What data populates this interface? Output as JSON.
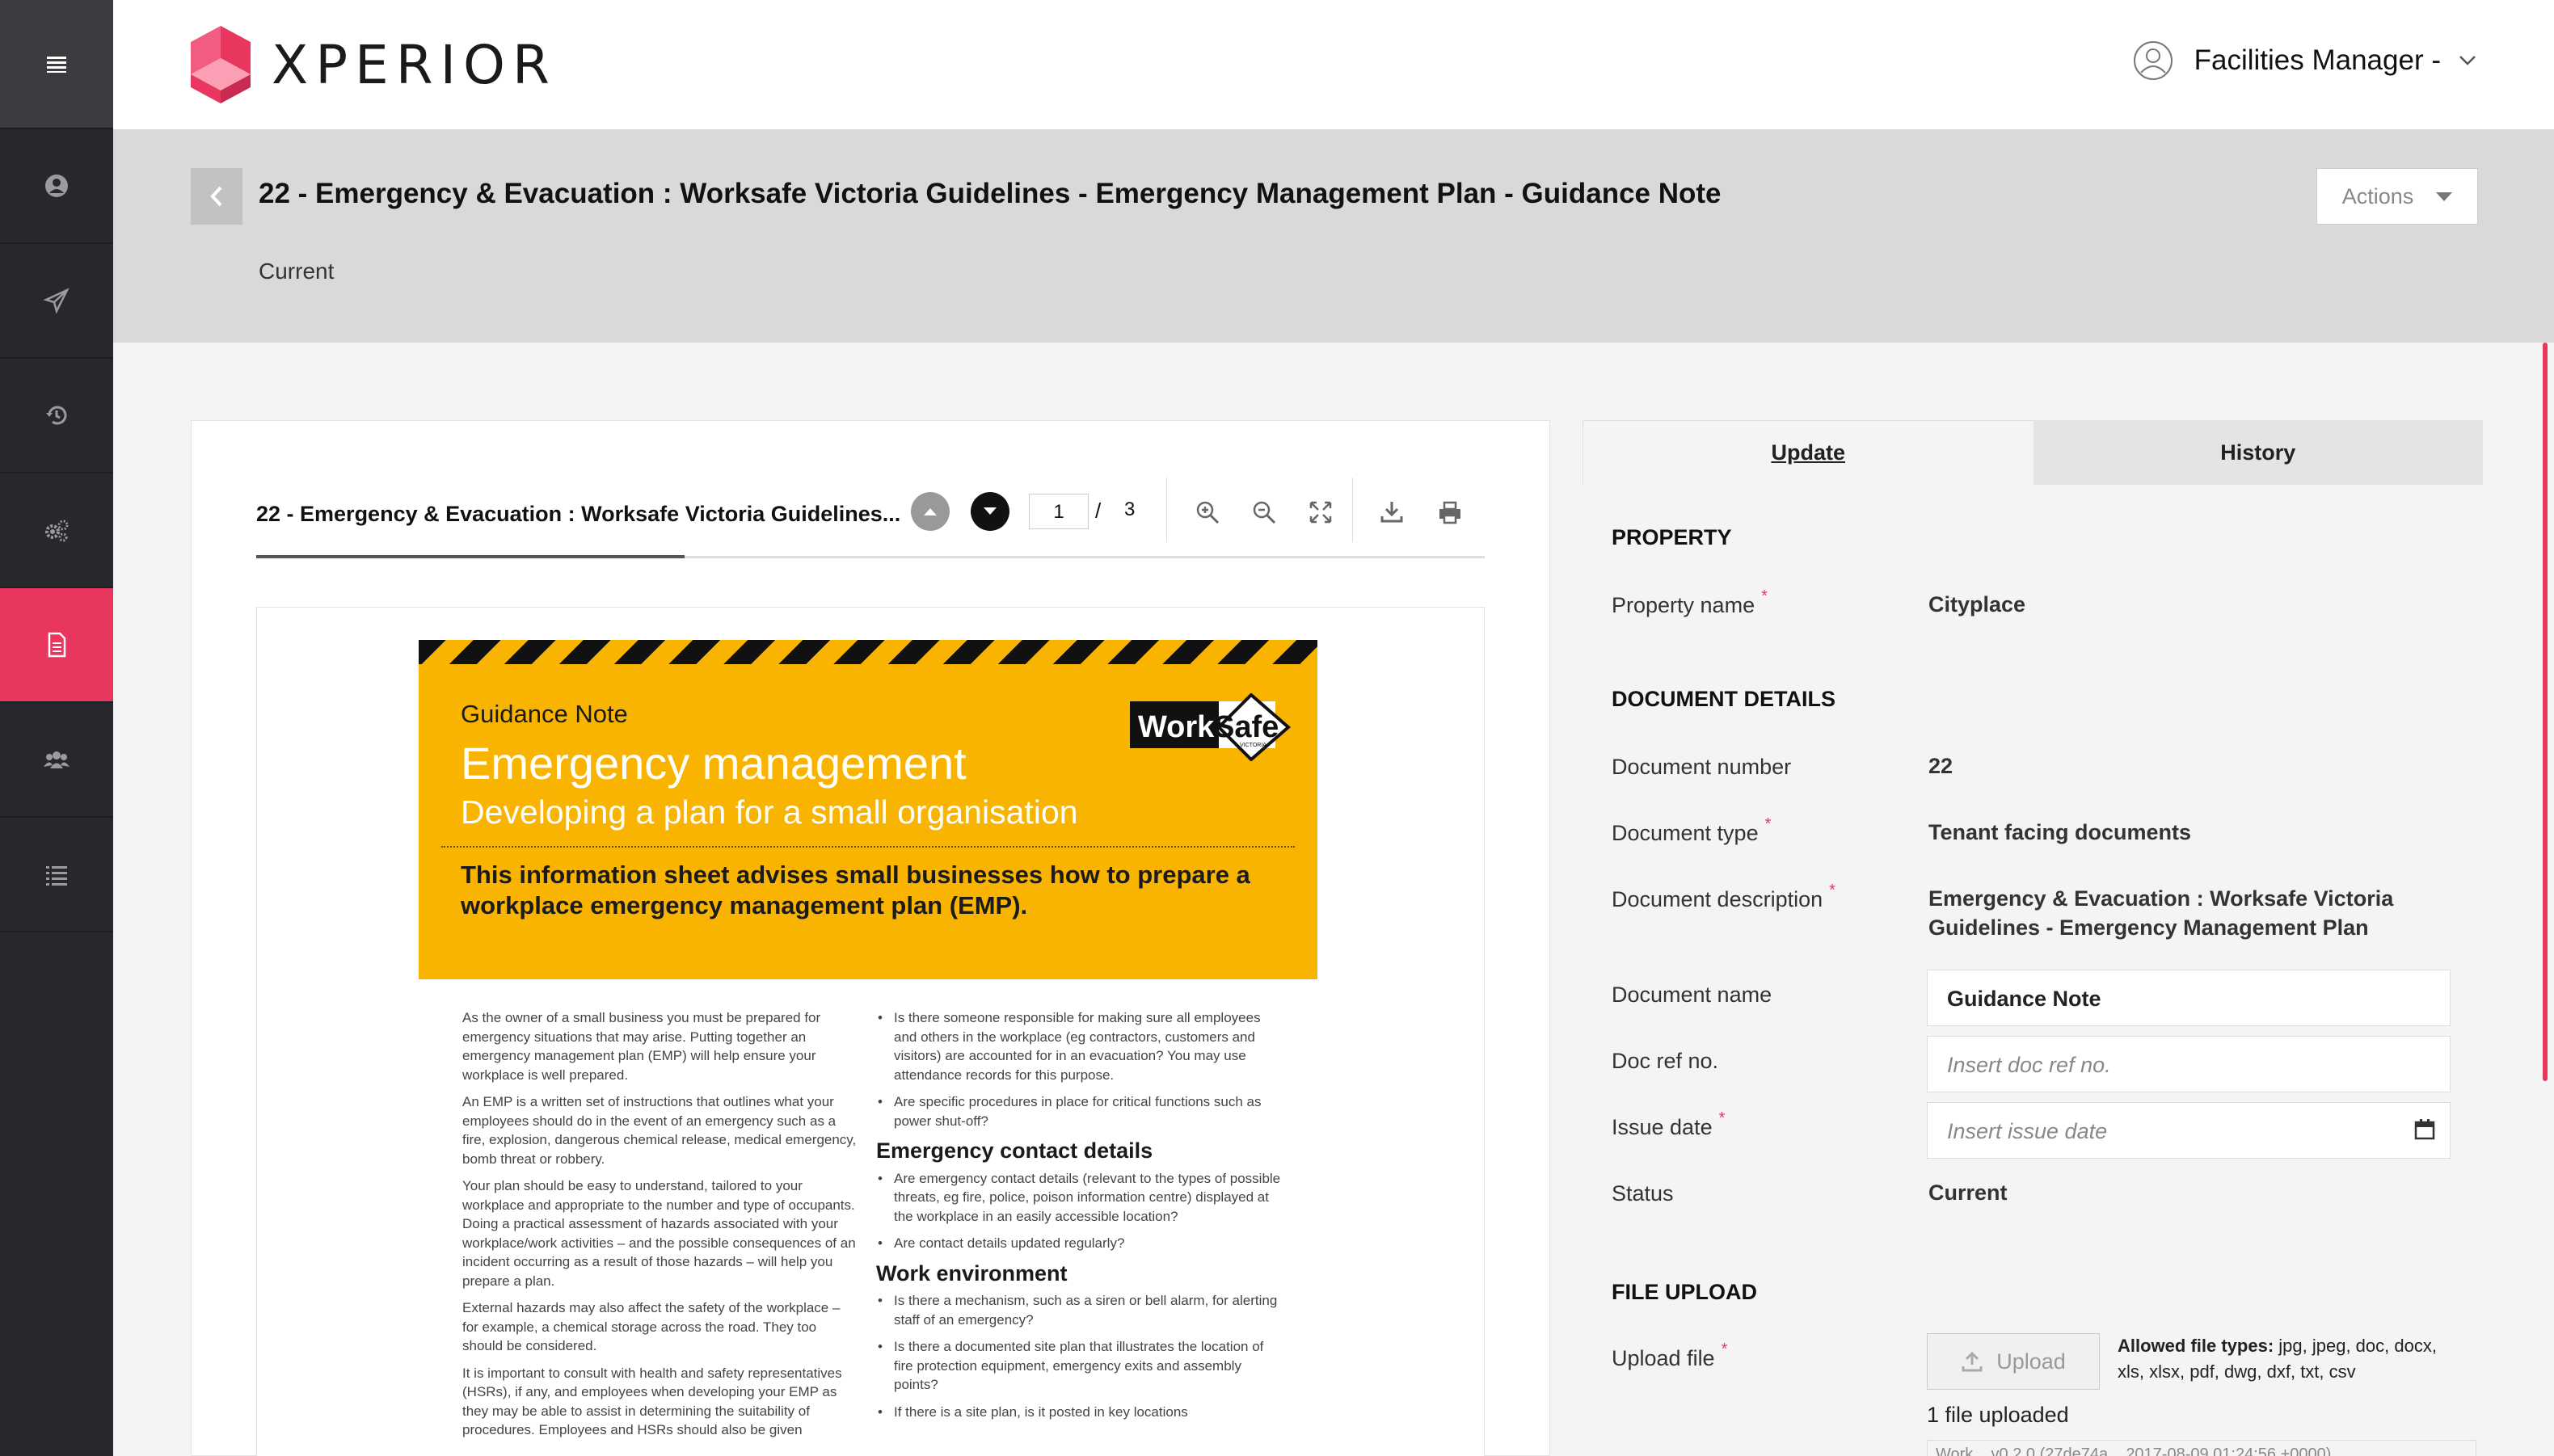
{
  "app": {
    "name": "XPERIOR",
    "user": "Facilities Manager -"
  },
  "colors": {
    "accent": "#e8365f",
    "sidebar": "#27282c",
    "banner": "#f9b401"
  },
  "sidebar": {
    "items": [
      {
        "icon": "menu-icon"
      },
      {
        "icon": "user-circle-icon"
      },
      {
        "icon": "paper-plane-icon"
      },
      {
        "icon": "history-icon"
      },
      {
        "icon": "gears-icon"
      },
      {
        "icon": "document-icon",
        "active": true
      },
      {
        "icon": "users-icon"
      },
      {
        "icon": "list-icon"
      }
    ]
  },
  "header": {
    "title": "22 - Emergency & Evacuation : Worksafe Victoria Guidelines - Emergency Management Plan - Guidance Note",
    "status": "Current",
    "actions_label": "Actions"
  },
  "viewer": {
    "title": "22 - Emergency & Evacuation : Worksafe Victoria Guidelines...",
    "current_page": "1",
    "separator": "/",
    "total_pages": "3"
  },
  "document": {
    "kicker": "Guidance Note",
    "title": "Emergency management",
    "subtitle": "Developing a plan for a small organisation",
    "description": "This information sheet advises small businesses how to prepare a workplace emergency management plan (EMP).",
    "logo_text_1": "Work",
    "logo_text_2": "Safe",
    "logo_small": "VICTORIA",
    "left_col": [
      "As the owner of a small business you must be prepared for emergency situations that may arise. Putting together an emergency management plan (EMP) will help ensure your workplace is well prepared.",
      "An EMP is a written set of instructions that outlines what your employees should do in the event of an emergency such as a fire, explosion, dangerous chemical release, medical emergency, bomb threat or robbery.",
      "Your plan should be easy to understand, tailored to your workplace and appropriate to the number and type of occupants. Doing a practical assessment of hazards associated with your workplace/work activities – and the possible consequences of an incident occurring as a result of those hazards – will help you prepare a plan.",
      "External hazards may also affect the safety of the workplace – for example, a chemical storage across the road. They too should be considered.",
      "It is important to consult with health and safety representatives (HSRs), if any, and employees when developing your EMP as they may be able to assist in determining the suitability of procedures. Employees and HSRs should also be given"
    ],
    "right_col_top": [
      "Is there someone responsible for making sure all employees and others in the workplace (eg contractors, customers and visitors) are accounted for in an evacuation? You may use attendance records for this purpose.",
      "Are specific procedures in place for critical functions such as power shut-off?"
    ],
    "heading_contact": "Emergency contact details",
    "contact_items": [
      "Are emergency contact details (relevant to the types of possible threats, eg fire, police, poison information centre) displayed at the workplace in an easily accessible location?",
      "Are contact details updated regularly?"
    ],
    "heading_work": "Work environment",
    "work_items": [
      "Is there a mechanism, such as a siren or bell alarm, for alerting staff of an emergency?",
      "Is there a documented site plan that illustrates the location of fire protection equipment, emergency exits and assembly points?",
      "If there is a site plan, is it posted in key locations"
    ]
  },
  "panel": {
    "tabs": [
      "Update",
      "History"
    ],
    "property_heading": "PROPERTY",
    "property_name_label": "Property name",
    "property_name": "Cityplace",
    "details_heading": "DOCUMENT DETAILS",
    "doc_number_label": "Document number",
    "doc_number": "22",
    "doc_type_label": "Document type",
    "doc_type": "Tenant facing documents",
    "doc_desc_label": "Document description",
    "doc_desc_1": "Emergency & Evacuation : Worksafe Victoria",
    "doc_desc_2": "Guidelines - Emergency Management Plan",
    "doc_name_label": "Document name",
    "doc_name": "Guidance Note",
    "doc_ref_label": "Doc ref no.",
    "doc_ref_placeholder": "Insert doc ref no.",
    "issue_date_label": "Issue date",
    "issue_date_placeholder": "Insert issue date",
    "status_label": "Status",
    "status": "Current",
    "upload_heading": "FILE UPLOAD",
    "upload_label": "Upload file",
    "upload_button": "Upload",
    "allowed_label": "Allowed file types:",
    "allowed_types": "jpg, jpeg, doc, docx, xls, xlsx, pdf, dwg, dxf, txt, csv",
    "uploaded_text": "1 file uploaded",
    "file_row_text": "Work...                      v0.2.0 (27de74a... 2017-08-09 01:24:56 +0000)"
  }
}
